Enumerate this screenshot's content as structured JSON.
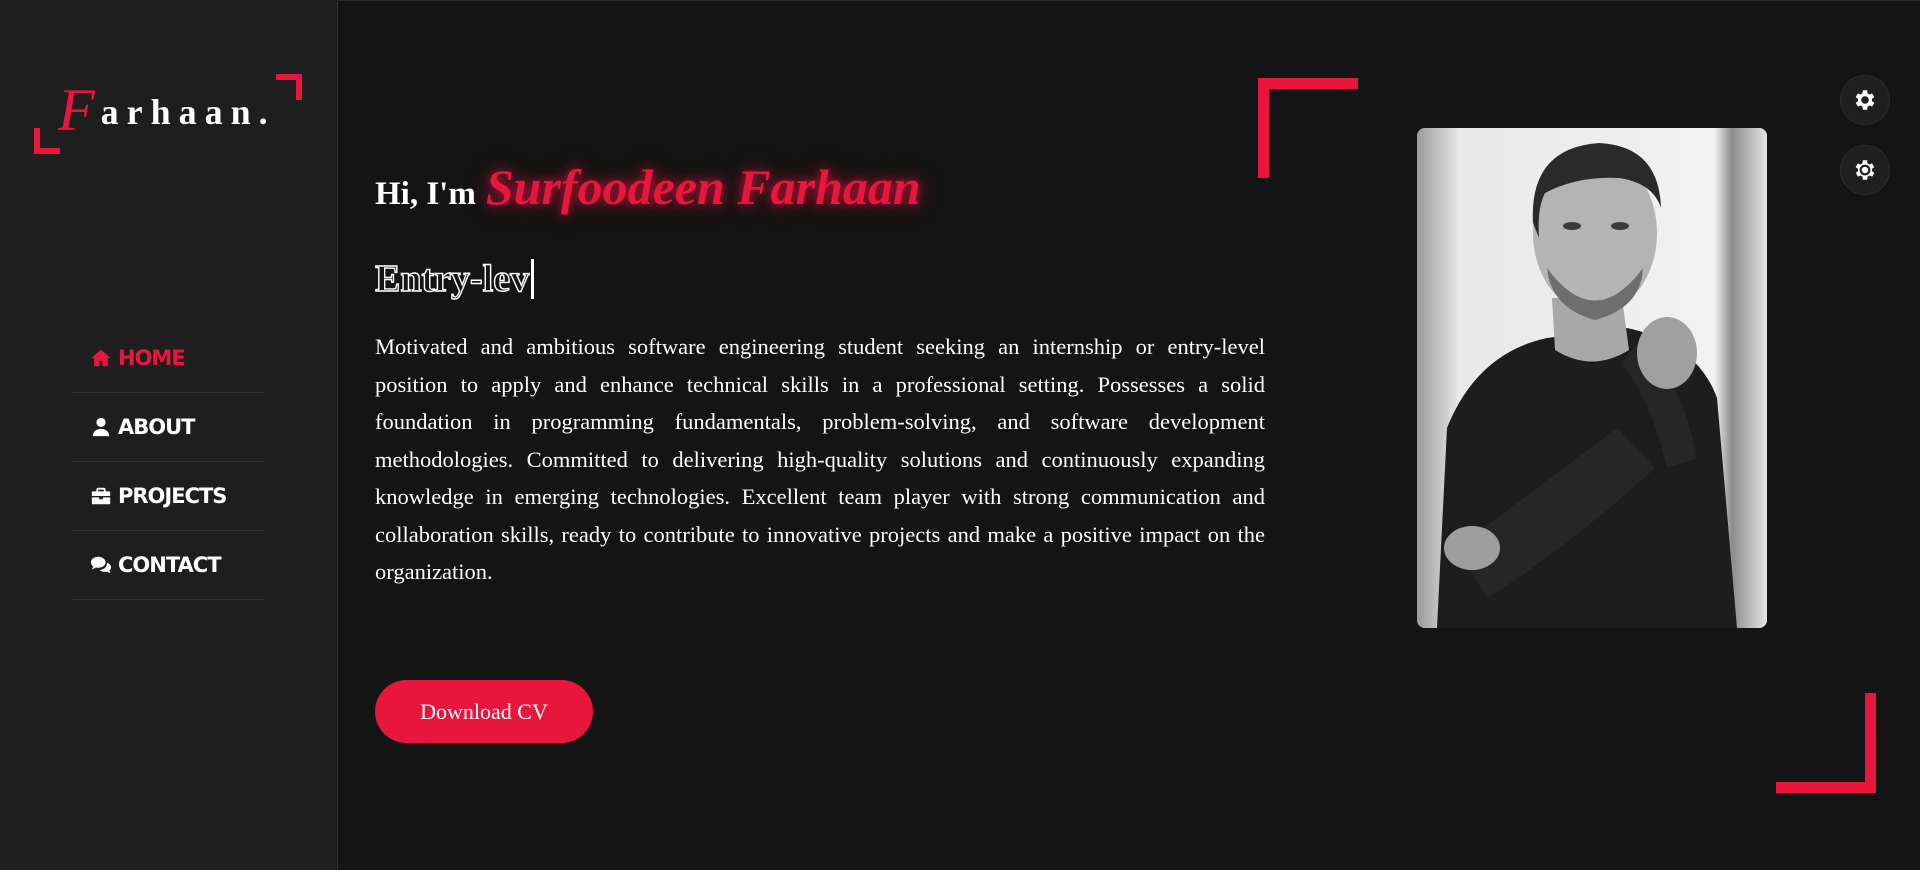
{
  "brand": {
    "initial": "F",
    "rest": "arhaan.",
    "accent_color": "#e8163d"
  },
  "nav": {
    "items": [
      {
        "label": "HOME",
        "icon": "home-icon",
        "active": true
      },
      {
        "label": "ABOUT",
        "icon": "user-icon",
        "active": false
      },
      {
        "label": "PROJECTS",
        "icon": "briefcase-icon",
        "active": false
      },
      {
        "label": "CONTACT",
        "icon": "comments-icon",
        "active": false
      }
    ]
  },
  "hero": {
    "greeting": "Hi, I'm",
    "name": "Surfoodeen Farhaan",
    "typed_text": "Entry-lev",
    "bio": "Motivated and ambitious software engineering student seeking an internship or entry-level position to apply and enhance technical skills in a professional setting. Possesses a solid foundation in programming fundamentals, problem-solving, and software development methodologies. Committed to delivering high-quality solutions and continuously expanding knowledge in emerging technologies. Excellent team player with strong communication and collaboration skills, ready to contribute to innovative projects and make a positive impact on the organization.",
    "cta_label": "Download CV"
  },
  "settings": {
    "buttons": [
      "gear-icon",
      "gear-outline-icon"
    ]
  },
  "colors": {
    "background": "#141414",
    "sidebar": "#1e1e1e",
    "accent": "#e8163d",
    "text": "#ffffff"
  }
}
